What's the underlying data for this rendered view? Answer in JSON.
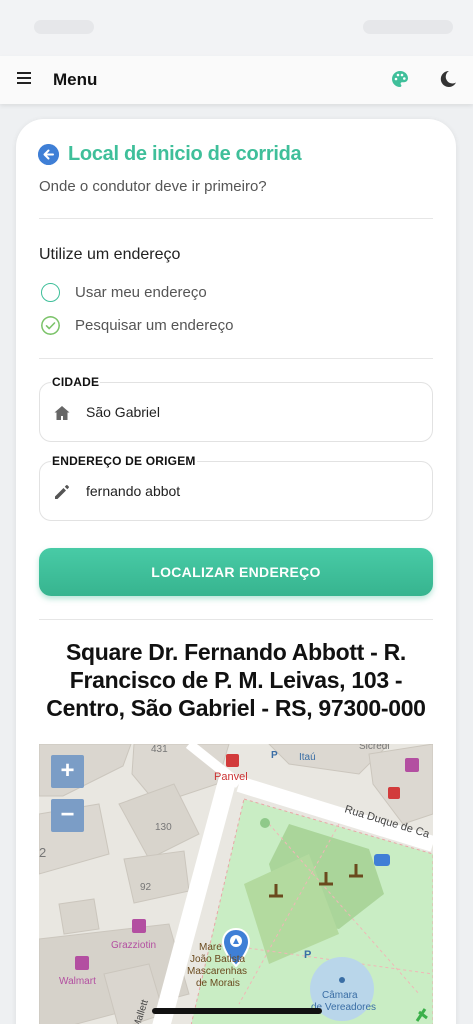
{
  "topbar": {
    "menu_label": "Menu",
    "icons": [
      "hamburger-icon",
      "palette-icon",
      "moon-icon"
    ]
  },
  "form": {
    "title": "Local de inicio de corrida",
    "subtitle": "Onde o condutor deve ir primeiro?",
    "section_label": "Utilize um endereço",
    "options": [
      {
        "label": "Usar meu endereço",
        "selected": false
      },
      {
        "label": "Pesquisar um endereço",
        "selected": true
      }
    ],
    "city": {
      "label": "CIDADE",
      "value": "São Gabriel",
      "icon": "house-icon"
    },
    "origin": {
      "label": "ENDEREÇO DE ORIGEM",
      "value": "fernando abbot",
      "icon": "pencil-icon"
    },
    "locate_button": "LOCALIZAR ENDEREÇO"
  },
  "result": {
    "address_lines": [
      "Square Dr. Fernando Abbott - R.",
      "Francisco de P. M. Leivas, 103 -",
      "Centro, São Gabriel - RS, 97300-000"
    ]
  },
  "map": {
    "zoom_in": "+",
    "zoom_out": "−",
    "labels": {
      "l431": "431",
      "panvel": "Panvel",
      "itau": "Itaú",
      "sicredi": "Sicredi",
      "rua_duque": "Rua Duque de Ca",
      "l130": "130",
      "l2": "2",
      "l92": "92",
      "grazziotin": "Grazziotin",
      "walmart": "Walmart",
      "marker_line1": "Mare",
      "marker_line2": "João Batista",
      "marker_line3": "Mascarenhas",
      "marker_line4": "de Morais",
      "mallett": "Mallett",
      "camara1": "Câmara",
      "camara2": "de Vereadores"
    },
    "colors": {
      "park": "#c6ecc3",
      "brand": "#3fbf9a",
      "pin": "#3f7fd6"
    }
  }
}
